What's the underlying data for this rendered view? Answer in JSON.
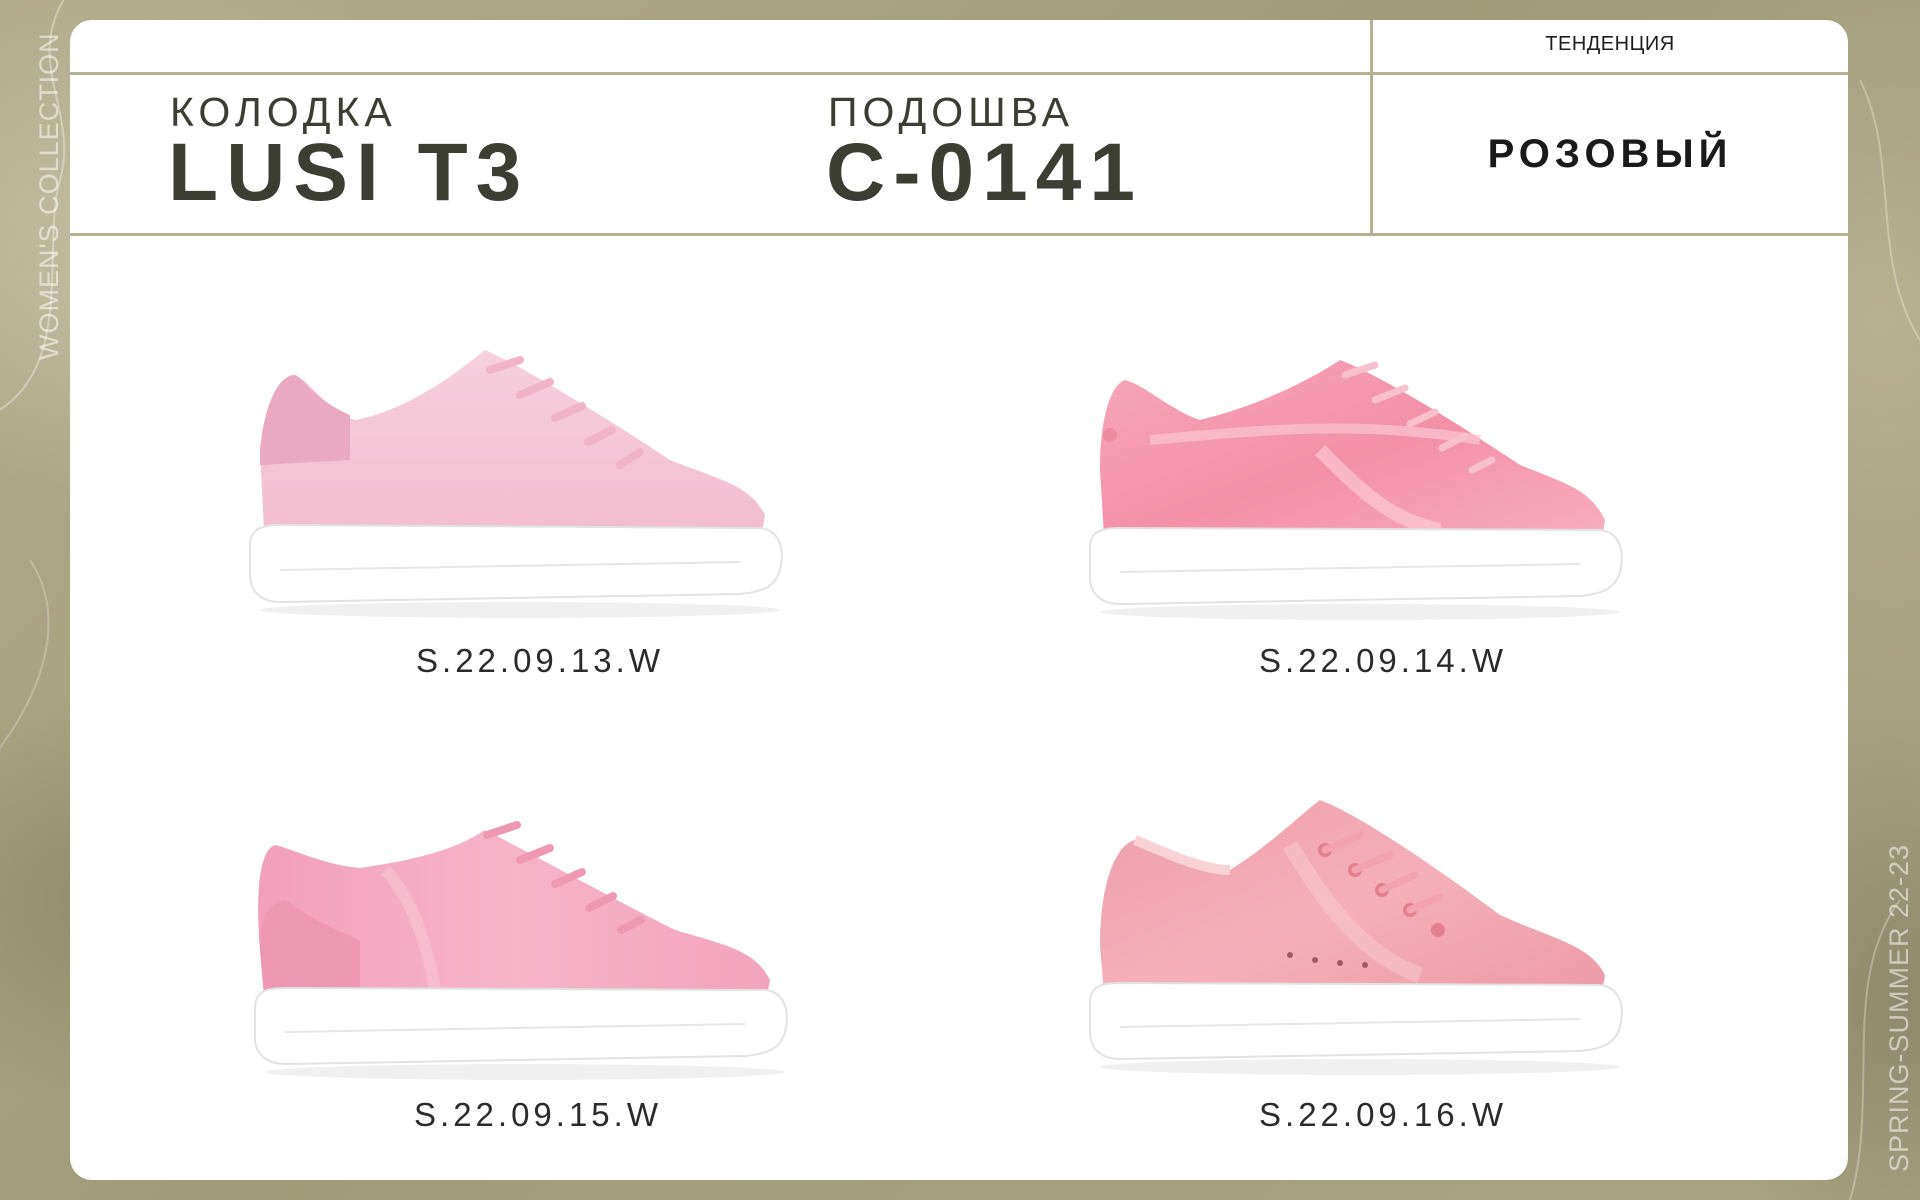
{
  "side": {
    "left_text": "WOMEN'S COLLECTION",
    "right_text": "SPRING-SUMMER 22-23"
  },
  "header": {
    "last_label": "КОЛОДКА",
    "last_value": "LUSI T3",
    "sole_label": "ПОДОШВА",
    "sole_value": "C-0141",
    "trend_label": "ТЕНДЕНЦИЯ",
    "trend_value": "РОЗОВЫЙ"
  },
  "products": [
    {
      "code": "S.22.09.13.W",
      "icon": "pink-nubuck-sneaker-image",
      "upper_color": "#f5c6d6",
      "trim_color": "#e7a4bc",
      "finish": "matte"
    },
    {
      "code": "S.22.09.14.W",
      "icon": "pink-patent-sneaker-image",
      "upper_color": "#f59ab0",
      "trim_color": "#ec8aa2",
      "finish": "gloss"
    },
    {
      "code": "S.22.09.15.W",
      "icon": "pink-leather-sneaker-image",
      "upper_color": "#f3a8c0",
      "trim_color": "#e88fab",
      "finish": "satin"
    },
    {
      "code": "S.22.09.16.W",
      "icon": "rose-patent-sneaker-image",
      "upper_color": "#eb9ea8",
      "trim_color": "#e08c98",
      "finish": "gloss"
    }
  ]
}
